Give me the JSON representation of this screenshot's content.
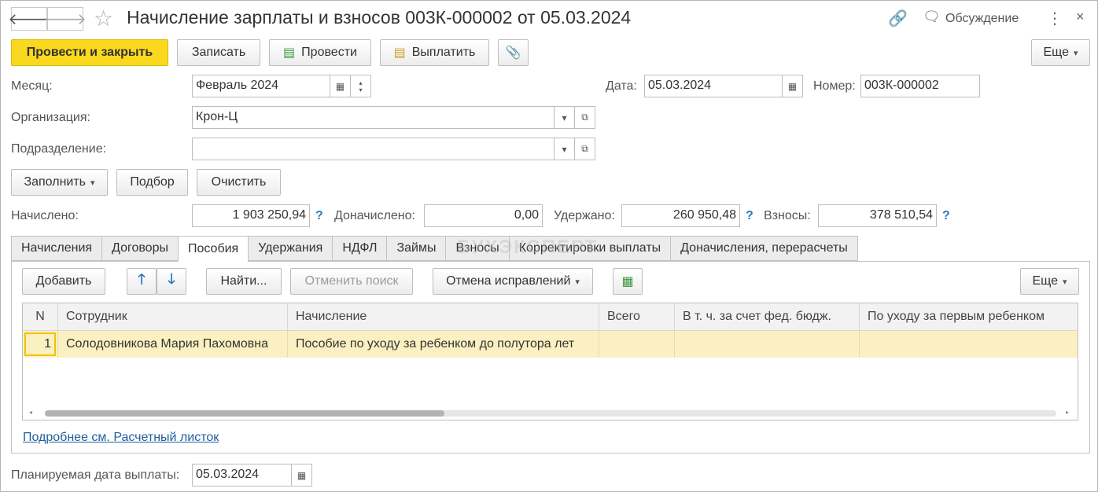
{
  "header": {
    "title": "Начисление зарплаты и взносов 003К-000002 от 05.03.2024",
    "discussion": "Обсуждение"
  },
  "toolbar": {
    "post_close": "Провести и закрыть",
    "save": "Записать",
    "post": "Провести",
    "pay": "Выплатить",
    "more": "Еще"
  },
  "form": {
    "month_label": "Месяц:",
    "month_value": "Февраль 2024",
    "date_label": "Дата:",
    "date_value": "05.03.2024",
    "number_label": "Номер:",
    "number_value": "003К-000002",
    "org_label": "Организация:",
    "org_value": "Крон-Ц",
    "dept_label": "Подразделение:",
    "dept_value": ""
  },
  "actions": {
    "fill": "Заполнить",
    "select": "Подбор",
    "clear": "Очистить"
  },
  "totals": {
    "accrued_label": "Начислено:",
    "accrued_value": "1 903 250,94",
    "additional_label": "Доначислено:",
    "additional_value": "0,00",
    "withheld_label": "Удержано:",
    "withheld_value": "260 950,48",
    "contrib_label": "Взносы:",
    "contrib_value": "378 510,54",
    "help_mark": "?"
  },
  "watermark": "БУХЭКСПЕРТ",
  "tabs": [
    "Начисления",
    "Договоры",
    "Пособия",
    "Удержания",
    "НДФЛ",
    "Займы",
    "Взносы",
    "Корректировки выплаты",
    "Доначисления, перерасчеты"
  ],
  "active_tab": "Пособия",
  "tab_toolbar": {
    "add": "Добавить",
    "find": "Найти...",
    "cancel_search": "Отменить поиск",
    "cancel_fix": "Отмена исправлений",
    "more": "Еще"
  },
  "table": {
    "columns": [
      "N",
      "Сотрудник",
      "Начисление",
      "Всего",
      "В т. ч. за счет фед. бюдж.",
      "По уходу за первым ребенком"
    ],
    "rows": [
      [
        "1",
        "Солодовникова Мария Пахомовна",
        "Пособие по уходу за ребенком до полутора лет",
        "",
        "",
        ""
      ]
    ]
  },
  "payslip_link": "Подробнее см. Расчетный листок",
  "planned": {
    "label": "Планируемая дата выплаты:",
    "value": "05.03.2024"
  }
}
